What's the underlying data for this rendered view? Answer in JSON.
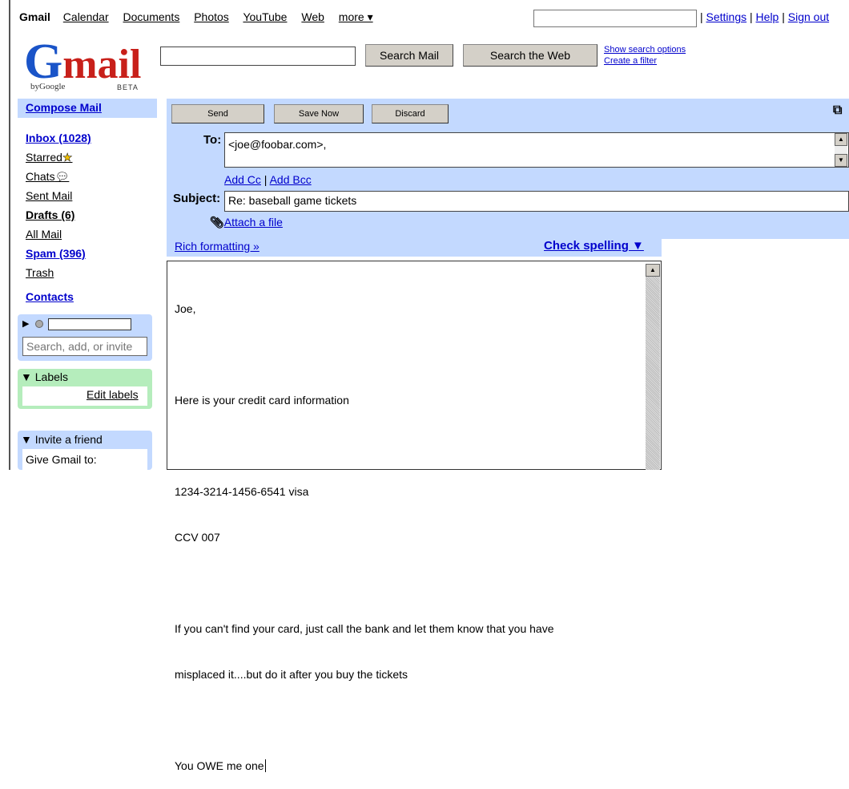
{
  "topnav": {
    "brand": "Gmail",
    "links": [
      "Calendar",
      "Documents",
      "Photos",
      "YouTube",
      "Web",
      "more ▾"
    ],
    "settings": "Settings",
    "help": "Help",
    "signout": "Sign out",
    "search_value": ""
  },
  "logo": {
    "text_g": "G",
    "text_mail": "mail",
    "by": "byGoogle",
    "beta": "BETA"
  },
  "search": {
    "mail_button": "Search Mail",
    "web_button": "Search the Web",
    "show_options": "Show search options",
    "create_filter": "Create a filter",
    "value": ""
  },
  "sidebar": {
    "compose": "Compose Mail",
    "items": [
      {
        "label": "Inbox (1028)",
        "bold": true
      },
      {
        "label": "Starred",
        "icon": "star-icon"
      },
      {
        "label": "Chats",
        "icon": "chat-bubble-icon"
      },
      {
        "label": "Sent Mail"
      },
      {
        "label": "Drafts (6)",
        "bold": true
      },
      {
        "label": "All Mail"
      },
      {
        "label": "Spam (396)",
        "bold": true
      },
      {
        "label": "Trash"
      }
    ],
    "contacts": "Contacts",
    "chat_placeholder": "Search, add, or invite",
    "labels_head": "Labels",
    "edit_labels": "Edit labels",
    "invite_head": "Invite a friend",
    "invite_text": "Give Gmail to:"
  },
  "compose": {
    "send": "Send",
    "save_now": "Save Now",
    "discard": "Discard",
    "to_label": "To:",
    "to_value": "<joe@foobar.com>,",
    "add_cc": "Add Cc",
    "add_bcc": "Add Bcc",
    "subject_label": "Subject:",
    "subject_value": "Re: baseball game tickets",
    "attach": "Attach a file",
    "rich": "Rich formatting »",
    "spell": "Check spelling ▼",
    "body": [
      "Joe,",
      "",
      "Here is your credit card information",
      "",
      "1234-3214-1456-6541 visa",
      "CCV 007",
      "",
      "If you can't find your card, just call the bank and let them know that you have",
      "misplaced it....but do it after you buy the tickets",
      "",
      "You OWE me one"
    ]
  },
  "colors": {
    "accent_blue": "#c3d9ff",
    "labels_green": "#b5edbc",
    "link": "#0000cc"
  }
}
